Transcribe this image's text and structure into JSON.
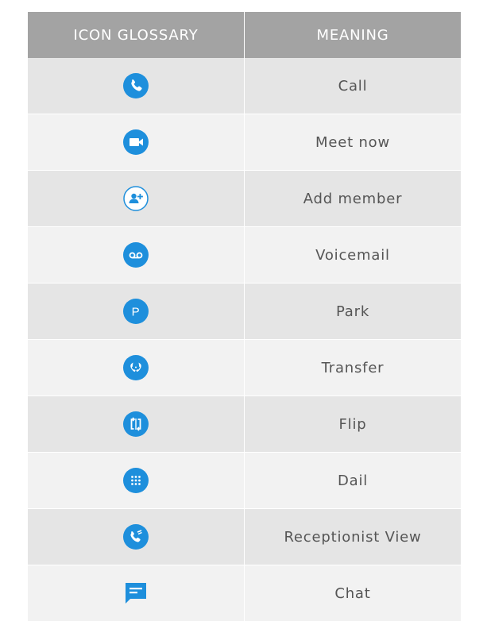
{
  "header": {
    "icon_col": "ICON GLOSSARY",
    "meaning_col": "MEANING"
  },
  "accent_color": "#1e8fdc",
  "header_color": "#a3a3a3",
  "rows": [
    {
      "icon": "phone-icon",
      "meaning": "Call"
    },
    {
      "icon": "video-camera-icon",
      "meaning": "Meet now"
    },
    {
      "icon": "add-member-icon",
      "meaning": "Add member"
    },
    {
      "icon": "voicemail-icon",
      "meaning": "Voicemail"
    },
    {
      "icon": "park-icon",
      "meaning": "Park",
      "glyph": "P"
    },
    {
      "icon": "transfer-icon",
      "meaning": "Transfer"
    },
    {
      "icon": "flip-icon",
      "meaning": "Flip"
    },
    {
      "icon": "dialpad-icon",
      "meaning": "Dail"
    },
    {
      "icon": "receptionist-view-icon",
      "meaning": "Receptionist View"
    },
    {
      "icon": "chat-icon",
      "meaning": "Chat"
    }
  ]
}
